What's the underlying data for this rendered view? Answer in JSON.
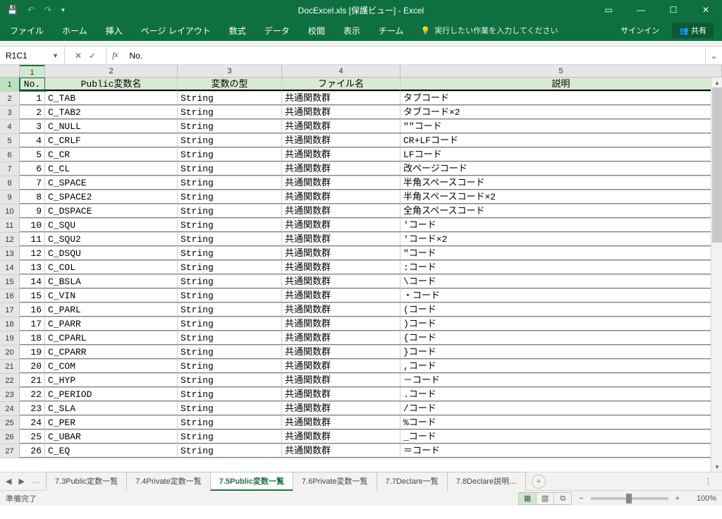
{
  "titlebar": {
    "title": "DocExcel.xls  [保護ビュー] - Excel"
  },
  "ribbon": {
    "tabs": [
      "ファイル",
      "ホーム",
      "挿入",
      "ページ レイアウト",
      "数式",
      "データ",
      "校閲",
      "表示",
      "チーム"
    ],
    "tellme": "実行したい作業を入力してください",
    "signin": "サインイン",
    "share": "共有"
  },
  "fx": {
    "namebox": "R1C1",
    "formula": "No."
  },
  "col_headers": [
    "1",
    "2",
    "3",
    "4",
    "5"
  ],
  "header_row": [
    "No.",
    "Public変数名",
    "変数の型",
    "ファイル名",
    "説明"
  ],
  "rows": [
    [
      "1",
      "C_TAB",
      "String",
      "共通関数群",
      "タブコード"
    ],
    [
      "2",
      "C_TAB2",
      "String",
      "共通関数群",
      "タブコード×2"
    ],
    [
      "3",
      "C_NULL",
      "String",
      "共通関数群",
      "\"\"コード"
    ],
    [
      "4",
      "C_CRLF",
      "String",
      "共通関数群",
      "CR+LFコード"
    ],
    [
      "5",
      "C_CR",
      "String",
      "共通関数群",
      "LFコード"
    ],
    [
      "6",
      "C_CL",
      "String",
      "共通関数群",
      "改ページコード"
    ],
    [
      "7",
      "C_SPACE",
      "String",
      "共通関数群",
      "半角スペースコード"
    ],
    [
      "8",
      "C_SPACE2",
      "String",
      "共通関数群",
      "半角スペースコード×2"
    ],
    [
      "9",
      "C_DSPACE",
      "String",
      "共通関数群",
      "全角スペースコード"
    ],
    [
      "10",
      "C_SQU",
      "String",
      "共通関数群",
      "'コード"
    ],
    [
      "11",
      "C_SQU2",
      "String",
      "共通関数群",
      "'コード×2"
    ],
    [
      "12",
      "C_DSQU",
      "String",
      "共通関数群",
      "\"コード"
    ],
    [
      "13",
      "C_COL",
      "String",
      "共通関数群",
      ":コード"
    ],
    [
      "14",
      "C_BSLA",
      "String",
      "共通関数群",
      "\\コード"
    ],
    [
      "15",
      "C_VIN",
      "String",
      "共通関数群",
      "・コード"
    ],
    [
      "16",
      "C_PARL",
      "String",
      "共通関数群",
      "(コード"
    ],
    [
      "17",
      "C_PARR",
      "String",
      "共通関数群",
      ")コード"
    ],
    [
      "18",
      "C_CPARL",
      "String",
      "共通関数群",
      "{コード"
    ],
    [
      "19",
      "C_CPARR",
      "String",
      "共通関数群",
      "}コード"
    ],
    [
      "20",
      "C_COM",
      "String",
      "共通関数群",
      ",コード"
    ],
    [
      "21",
      "C_HYP",
      "String",
      "共通関数群",
      "－コード"
    ],
    [
      "22",
      "C_PERIOD",
      "String",
      "共通関数群",
      ".コード"
    ],
    [
      "23",
      "C_SLA",
      "String",
      "共通関数群",
      "/コード"
    ],
    [
      "24",
      "C_PER",
      "String",
      "共通関数群",
      "%コード"
    ],
    [
      "25",
      "C_UBAR",
      "String",
      "共通関数群",
      "_コード"
    ],
    [
      "26",
      "C_EQ",
      "String",
      "共通関数群",
      "＝コード"
    ]
  ],
  "sheets": {
    "list": [
      "7.3Public定数一覧",
      "7.4Private定数一覧",
      "7.5Public変数一覧",
      "7.6Private変数一覧",
      "7.7Declare一覧",
      "7.8Declare説明…"
    ],
    "active_index": 2,
    "ellipsis": "…"
  },
  "status": {
    "ready": "準備完了",
    "zoom": "100%"
  },
  "chart_data": {
    "type": "table",
    "title": "7.5Public変数一覧",
    "columns": [
      "No.",
      "Public変数名",
      "変数の型",
      "ファイル名",
      "説明"
    ]
  }
}
